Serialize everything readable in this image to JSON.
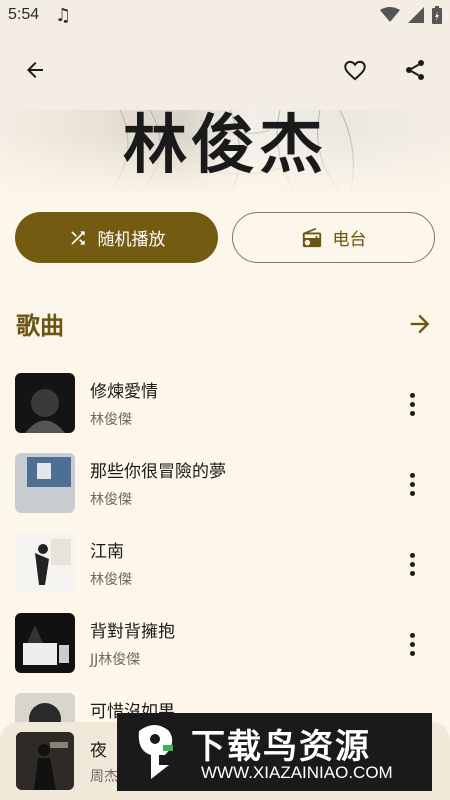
{
  "status_bar": {
    "time": "5:54"
  },
  "artist": {
    "name": "林俊杰"
  },
  "actions": {
    "shuffle_label": "随机播放",
    "radio_label": "电台"
  },
  "section": {
    "title": "歌曲"
  },
  "songs": [
    {
      "title": "修煉愛情",
      "artist": "林俊傑"
    },
    {
      "title": "那些你很冒險的夢",
      "artist": "林俊傑"
    },
    {
      "title": "江南",
      "artist": "林俊傑"
    },
    {
      "title": "背對背擁抱",
      "artist": "JJ林俊傑"
    },
    {
      "title": "可惜沒如果",
      "artist": ""
    }
  ],
  "now_playing": {
    "title": "夜",
    "artist": "周杰"
  },
  "watermark": {
    "brand": "下载鸟资源",
    "url": "WWW.XIAZAINIAO.COM"
  },
  "colors": {
    "accent": "#735c12",
    "background": "#fdf6ea",
    "toolbar": "#f4ede3"
  },
  "icons": [
    "back-arrow-icon",
    "heart-outline-icon",
    "share-icon",
    "shuffle-icon",
    "radio-icon",
    "arrow-right-icon",
    "more-vert-icon",
    "music-note-icon",
    "wifi-icon",
    "battery-icon"
  ]
}
